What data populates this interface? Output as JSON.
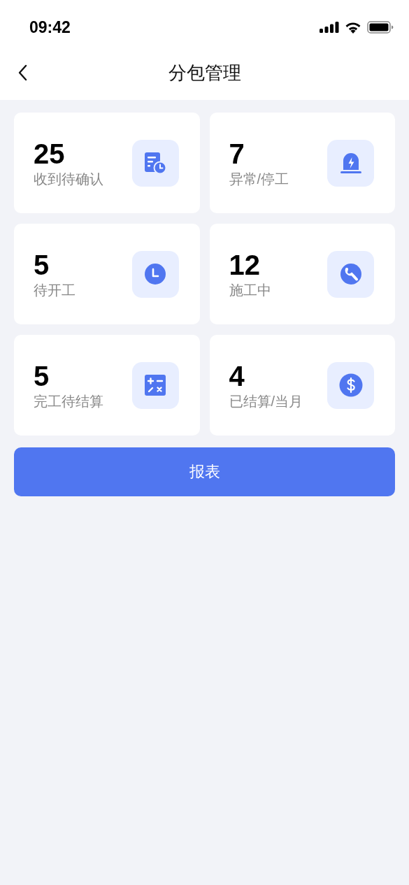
{
  "status_bar": {
    "time": "09:42"
  },
  "header": {
    "title": "分包管理"
  },
  "cards": [
    {
      "value": "25",
      "label": "收到待确认",
      "kind": "document-clock"
    },
    {
      "value": "7",
      "label": "异常/停工",
      "kind": "siren"
    },
    {
      "value": "5",
      "label": "待开工",
      "kind": "clock"
    },
    {
      "value": "12",
      "label": "施工中",
      "kind": "wrench"
    },
    {
      "value": "5",
      "label": "完工待结算",
      "kind": "calculator"
    },
    {
      "value": "4",
      "label": "已结算/当月",
      "kind": "dollar"
    }
  ],
  "report_button": {
    "label": "报表"
  }
}
